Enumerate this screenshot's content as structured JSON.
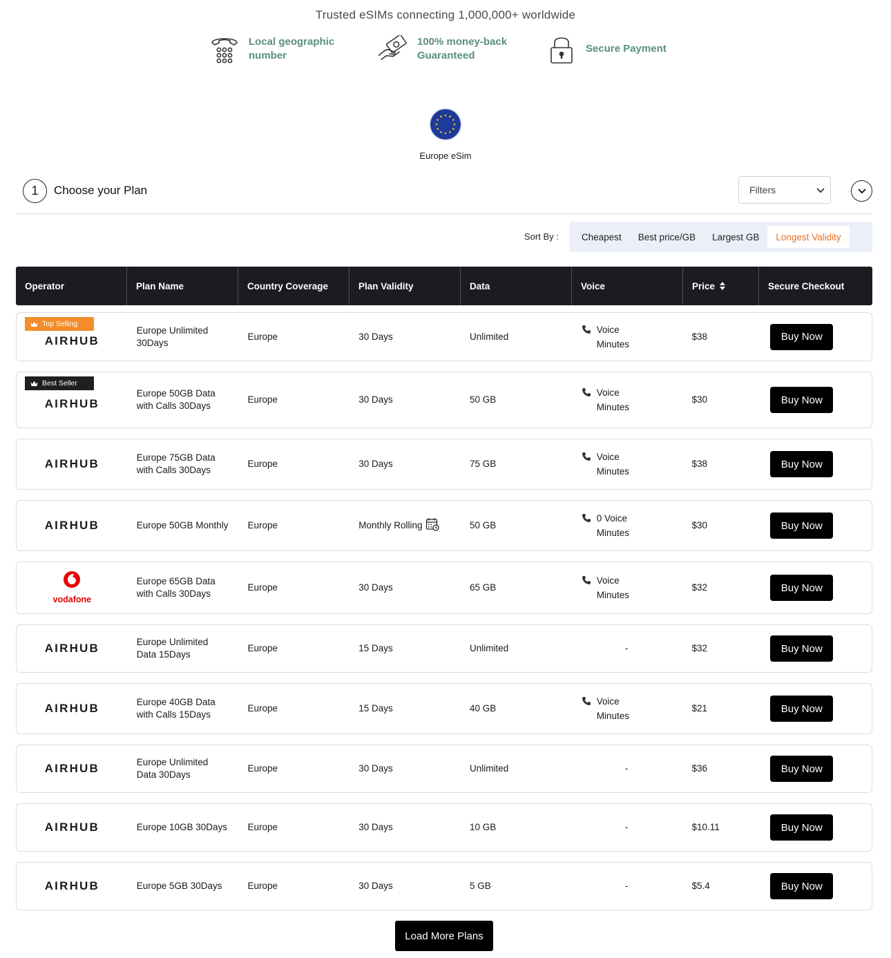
{
  "tagline": "Trusted eSIMs connecting 1,000,000+ worldwide",
  "trust": [
    {
      "icon": "phone-keypad-icon",
      "label": "Local geographic number"
    },
    {
      "icon": "money-back-icon",
      "label": "100% money-back Guaranteed"
    },
    {
      "icon": "padlock-icon",
      "label": "Secure Payment"
    }
  ],
  "region": {
    "flag": "eu-flag-icon",
    "label": "Europe eSim"
  },
  "step": {
    "number": "1",
    "title": "Choose your Plan"
  },
  "filters": {
    "selected": "Filters"
  },
  "sort": {
    "label": "Sort By :",
    "options": [
      "Cheapest",
      "Best price/GB",
      "Largest GB",
      "Longest Validity"
    ],
    "active": "Longest Validity"
  },
  "table": {
    "headers": [
      "Operator",
      "Plan Name",
      "Country Coverage",
      "Plan Validity",
      "Data",
      "Voice",
      "Price",
      "Secure Checkout"
    ],
    "rows": [
      {
        "operator": "AIRHUB",
        "badge": "Top Selling",
        "plan": "Europe Unlimited 30Days",
        "coverage": "Europe",
        "validity": "30 Days",
        "data": "Unlimited",
        "voice": "Voice Minutes",
        "price": "$38",
        "cta": "Buy Now"
      },
      {
        "operator": "AIRHUB",
        "badge": "Best Seller",
        "plan": "Europe 50GB Data with Calls 30Days",
        "coverage": "Europe",
        "validity": "30 Days",
        "data": "50 GB",
        "voice": "Voice Minutes",
        "price": "$30",
        "cta": "Buy Now"
      },
      {
        "operator": "AIRHUB",
        "plan": "Europe 75GB Data with Calls 30Days",
        "coverage": "Europe",
        "validity": "30 Days",
        "data": "75 GB",
        "voice": "Voice Minutes",
        "price": "$38",
        "cta": "Buy Now"
      },
      {
        "operator": "AIRHUB",
        "plan": "Europe 50GB Monthly",
        "coverage": "Europe",
        "validity": "Monthly Rolling",
        "data": "50 GB",
        "voice": "0 Voice Minutes",
        "price": "$30",
        "cta": "Buy Now"
      },
      {
        "operator": "vodafone",
        "plan": "Europe 65GB Data with Calls 30Days",
        "coverage": "Europe",
        "validity": "30 Days",
        "data": "65 GB",
        "voice": "Voice Minutes",
        "price": "$32",
        "cta": "Buy Now"
      },
      {
        "operator": "AIRHUB",
        "plan": "Europe Unlimited Data 15Days",
        "coverage": "Europe",
        "validity": "15 Days",
        "data": "Unlimited",
        "voice": "-",
        "price": "$32",
        "cta": "Buy Now"
      },
      {
        "operator": "AIRHUB",
        "plan": "Europe 40GB Data with Calls 15Days",
        "coverage": "Europe",
        "validity": "15 Days",
        "data": "40 GB",
        "voice": "Voice Minutes",
        "price": "$21",
        "cta": "Buy Now"
      },
      {
        "operator": "AIRHUB",
        "plan": "Europe Unlimited Data 30Days",
        "coverage": "Europe",
        "validity": "30 Days",
        "data": "Unlimited",
        "voice": "-",
        "price": "$36",
        "cta": "Buy Now"
      },
      {
        "operator": "AIRHUB",
        "plan": "Europe 10GB 30Days",
        "coverage": "Europe",
        "validity": "30 Days",
        "data": "10 GB",
        "voice": "-",
        "price": "$10.11",
        "cta": "Buy Now"
      },
      {
        "operator": "AIRHUB",
        "plan": "Europe 5GB 30Days",
        "coverage": "Europe",
        "validity": "30 Days",
        "data": "5 GB",
        "voice": "-",
        "price": "$5.4",
        "cta": "Buy Now"
      }
    ]
  },
  "load_more": "Load More Plans",
  "colors": {
    "accent": "#e9711c",
    "trust_text": "#5b8f80",
    "header_bg": "#1a1c21",
    "top_badge": "#f38d2b",
    "vodafone": "#e60000"
  }
}
